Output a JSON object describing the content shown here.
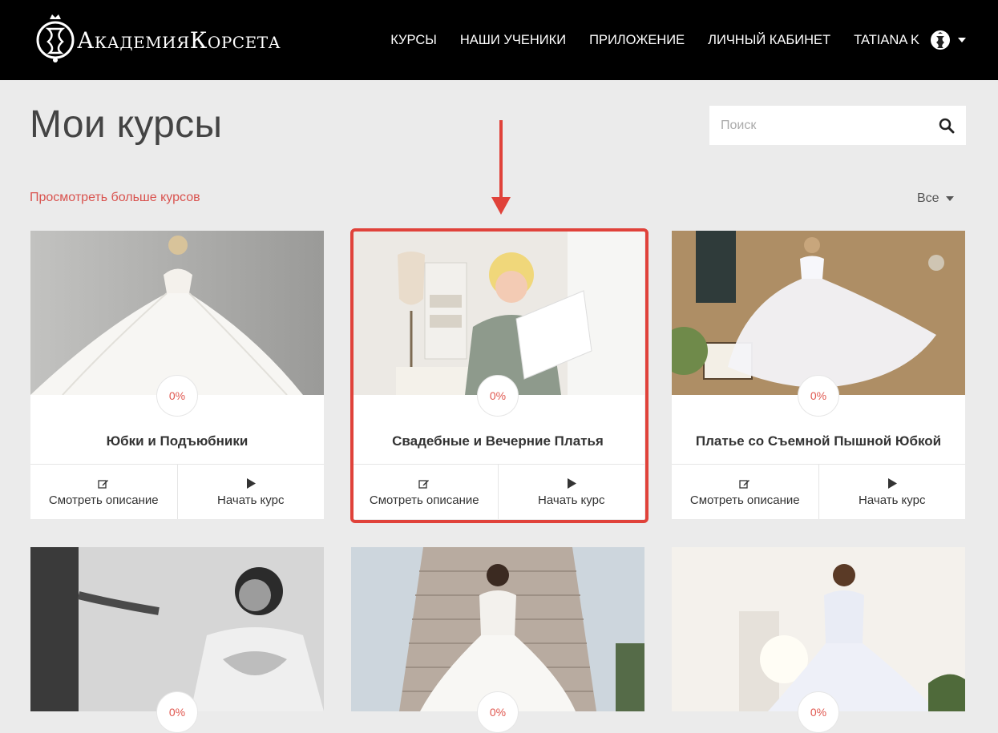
{
  "header": {
    "logo_text": "АкадемияКорсета",
    "nav": [
      "КУРСЫ",
      "НАШИ УЧЕНИКИ",
      "ПРИЛОЖЕНИЕ",
      "ЛИЧНЫЙ КАБИНЕТ"
    ],
    "user_name": "TATIANA K"
  },
  "page": {
    "title": "Мои курсы",
    "search_placeholder": "Поиск",
    "more_courses": "Просмотреть больше курсов",
    "filter_label": "Все"
  },
  "courses": [
    {
      "title": "Юбки и Подъюбники",
      "progress": "0%",
      "view_label": "Смотреть описание",
      "start_label": "Начать курс"
    },
    {
      "title": "Свадебные и Вечерние Платья",
      "progress": "0%",
      "view_label": "Смотреть описание",
      "start_label": "Начать курс"
    },
    {
      "title": "Платье со Съемной Пышной Юбкой",
      "progress": "0%",
      "view_label": "Смотреть описание",
      "start_label": "Начать курс"
    },
    {
      "title": "",
      "progress": "0%"
    },
    {
      "title": "",
      "progress": "0%"
    },
    {
      "title": "",
      "progress": "0%"
    }
  ],
  "colors": {
    "accent": "#e0574f",
    "highlight": "#e0423a",
    "header_bg": "#000000"
  },
  "icons": {
    "search": "search-icon",
    "view": "edit-icon",
    "start": "play-icon"
  }
}
